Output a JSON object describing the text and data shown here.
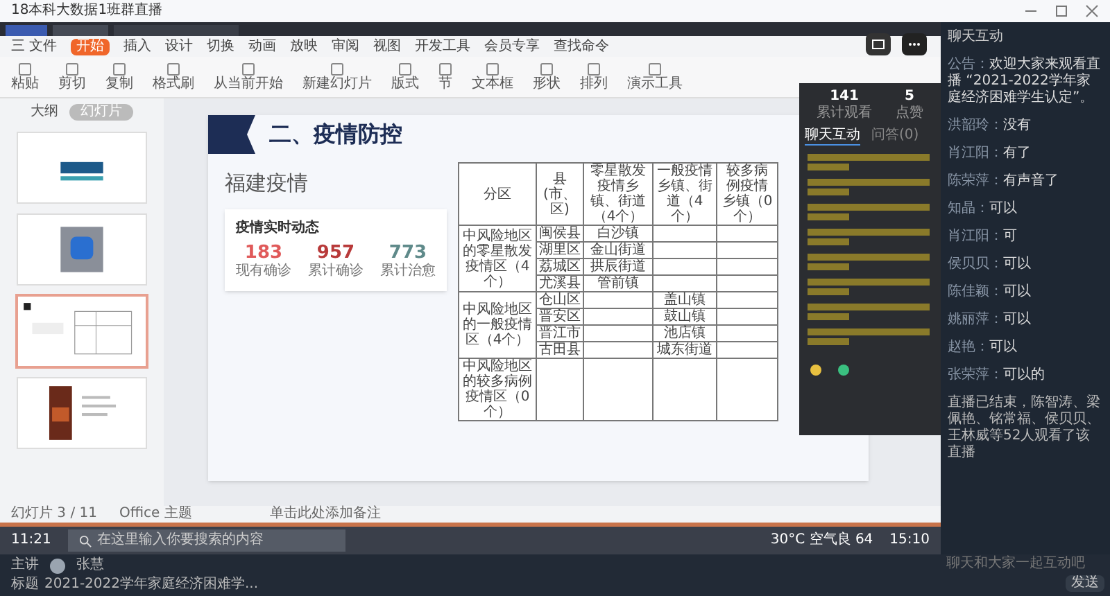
{
  "window": {
    "title": "18本科大数据1班群直播"
  },
  "menu": [
    {
      "label": "三 文件",
      "selected": false
    },
    {
      "label": "开始",
      "selected": true
    },
    {
      "label": "插入",
      "selected": false
    },
    {
      "label": "设计",
      "selected": false
    },
    {
      "label": "切换",
      "selected": false
    },
    {
      "label": "动画",
      "selected": false
    },
    {
      "label": "放映",
      "selected": false
    },
    {
      "label": "审阅",
      "selected": false
    },
    {
      "label": "视图",
      "selected": false
    },
    {
      "label": "开发工具",
      "selected": false
    },
    {
      "label": "会员专享",
      "selected": false
    },
    {
      "label": "查找命令",
      "selected": false
    }
  ],
  "ribbon": [
    "粘贴",
    "剪切",
    "复制",
    "格式刷",
    "从当前开始",
    "新建幻灯片",
    "版式",
    "节",
    "文本框",
    "形状",
    "排列",
    "演示工具"
  ],
  "outline_tabs": [
    {
      "label": "大纲",
      "selected": false
    },
    {
      "label": "幻灯片",
      "selected": true
    }
  ],
  "thumbnails": [
    {
      "kind": "banner",
      "selected": false
    },
    {
      "kind": "app",
      "selected": false
    },
    {
      "kind": "table",
      "selected": true
    },
    {
      "kind": "poster",
      "selected": false
    }
  ],
  "slide": {
    "title": "二、疫情防控",
    "subtitle": "福建疫情",
    "card": {
      "title": "疫情实时动态",
      "stats": [
        {
          "value": "183",
          "label": "现有确诊",
          "color": "#e05a5a"
        },
        {
          "value": "957",
          "label": "累计确诊",
          "color": "#b83a3a"
        },
        {
          "value": "773",
          "label": "累计治愈",
          "color": "#5f8a8a"
        }
      ]
    },
    "table": {
      "columns": [
        "分区",
        "县(市、区)",
        "零星散发疫情乡镇、街道（4个）",
        "一般疫情乡镇、街道（4个）",
        "较多病例疫情乡镇（0个）"
      ],
      "groups": [
        {
          "name": "中风险地区的零星散发疫情区（4个）",
          "rows": [
            {
              "county": "闽侯县",
              "sporadic": "白沙镇",
              "general": ""
            },
            {
              "county": "湖里区",
              "sporadic": "金山街道",
              "general": ""
            },
            {
              "county": "荔城区",
              "sporadic": "拱辰街道",
              "general": ""
            },
            {
              "county": "尤溪县",
              "sporadic": "管前镇",
              "general": ""
            }
          ]
        },
        {
          "name": "中风险地区的一般疫情区（4个）",
          "rows": [
            {
              "county": "仓山区",
              "sporadic": "",
              "general": "盖山镇"
            },
            {
              "county": "晋安区",
              "sporadic": "",
              "general": "鼓山镇"
            },
            {
              "county": "晋江市",
              "sporadic": "",
              "general": "池店镇"
            },
            {
              "county": "古田县",
              "sporadic": "",
              "general": "城东街道"
            }
          ]
        },
        {
          "name": "中风险地区的较多病例疫情区（0个）"
        }
      ]
    }
  },
  "status": {
    "slides": "幻灯片 3 / 11",
    "theme": "Office 主题",
    "notes": "单击此处添加备注"
  },
  "taskbar": {
    "time": "11:21",
    "search_placeholder": "在这里输入你要搜索的内容",
    "weather": "30°C 空气良 64",
    "clock": "15:10"
  },
  "popup": {
    "stats": [
      {
        "value": "141",
        "label": "累计观看"
      },
      {
        "value": "5",
        "label": "点赞"
      }
    ],
    "tabs": [
      {
        "label": "聊天互动",
        "selected": true
      },
      {
        "label": "问答(0)",
        "selected": false
      }
    ]
  },
  "chat": {
    "title": "聊天互动",
    "messages": [
      {
        "sender": "公告：",
        "text": "欢迎大家来观看直播 “2021-2022学年家庭经济困难学生认定”。"
      },
      {
        "sender": "洪韶玲：",
        "text": "没有"
      },
      {
        "sender": "肖江阳：",
        "text": "有了"
      },
      {
        "sender": "陈荣萍：",
        "text": "有声音了"
      },
      {
        "sender": "知晶：",
        "text": "可以"
      },
      {
        "sender": "肖江阳：",
        "text": "可"
      },
      {
        "sender": "侯贝贝：",
        "text": "可以"
      },
      {
        "sender": "陈佳颖：",
        "text": "可以"
      },
      {
        "sender": "姚丽萍：",
        "text": "可以"
      },
      {
        "sender": "赵艳：",
        "text": "可以"
      },
      {
        "sender": "张荣萍：",
        "text": "可以的"
      }
    ],
    "notice": "直播已结束，陈智涛、梁佩艳、铭常福、侯贝贝、王林威等52人观看了该直播",
    "placeholder": "聊天和大家一起互动吧",
    "send": "发送"
  },
  "footer": {
    "host_label": "主讲",
    "host": "张慧",
    "title_label": "标题",
    "title": "2021-2022学年家庭经济困难学..."
  }
}
